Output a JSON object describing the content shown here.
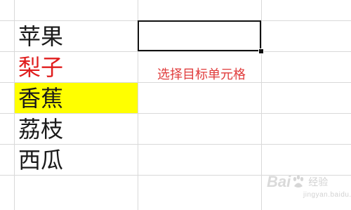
{
  "cells": [
    {
      "text": "苹果",
      "color": "#1a1a1a",
      "fill": null
    },
    {
      "text": "梨子",
      "color": "#e01e1e",
      "fill": null
    },
    {
      "text": "香蕉",
      "color": "#1a1a1a",
      "fill": "#ffff00"
    },
    {
      "text": "荔枝",
      "color": "#1a1a1a",
      "fill": null
    },
    {
      "text": "西瓜",
      "color": "#1a1a1a",
      "fill": null
    }
  ],
  "annotation": {
    "text": "选择目标单元格",
    "color": "#e03c3c"
  },
  "watermark": {
    "logo": "Baidu",
    "cn": "经验",
    "sub": "jingyan.baidu.com"
  }
}
